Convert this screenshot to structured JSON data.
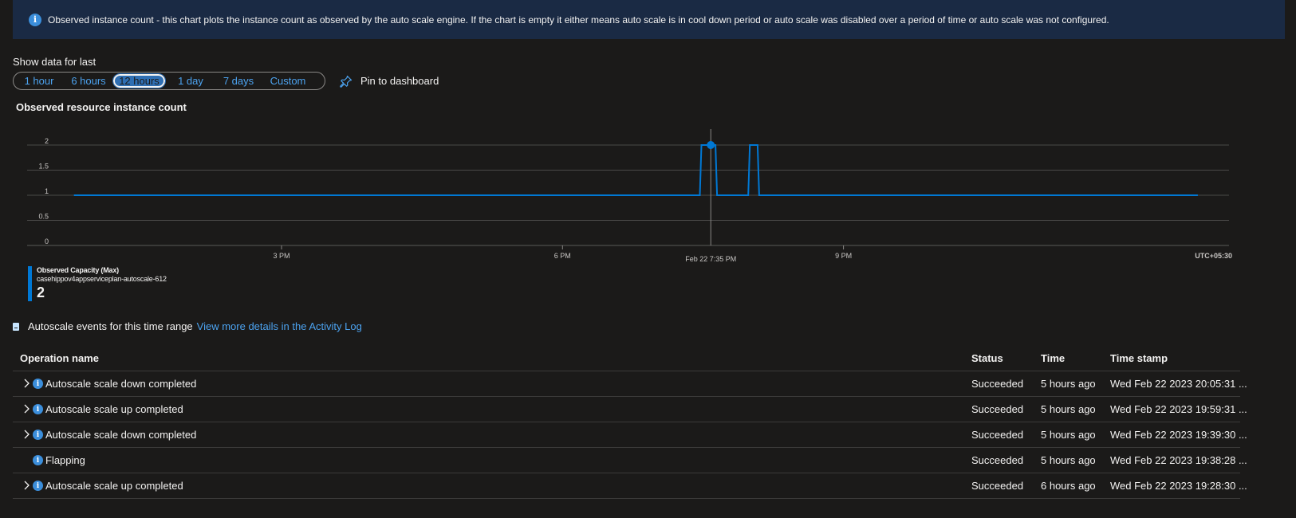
{
  "banner": {
    "text": "Observed instance count - this chart plots the instance count as observed by the auto scale engine. If the chart is empty it either means auto scale is in cool down period or auto scale was disabled over a period of time or auto scale was not configured."
  },
  "time_range": {
    "label": "Show data for last",
    "options": [
      "1 hour",
      "6 hours",
      "12 hours",
      "1 day",
      "7 days",
      "Custom"
    ],
    "selected": "12 hours",
    "pin_label": "Pin to dashboard"
  },
  "chart_data": {
    "type": "line",
    "title": "Observed resource instance count",
    "x_ticks": [
      "3 PM",
      "6 PM",
      "9 PM"
    ],
    "y_ticks": [
      "2",
      "1.5",
      "1",
      "0.5",
      "0"
    ],
    "ylim": [
      0,
      2
    ],
    "timezone": "UTC+05:30",
    "cursor_label": "Feb 22 7:35 PM",
    "grid": true,
    "series": [
      {
        "name": "Observed Capacity (Max)",
        "color": "#0078d4",
        "points": [
          {
            "t": "12:47 PM",
            "v": 1
          },
          {
            "t": "7:28 PM",
            "v": 1
          },
          {
            "t": "7:29 PM",
            "v": 2
          },
          {
            "t": "7:38 PM",
            "v": 2
          },
          {
            "t": "7:39 PM",
            "v": 1
          },
          {
            "t": "7:59 PM",
            "v": 1
          },
          {
            "t": "8:00 PM",
            "v": 2
          },
          {
            "t": "8:05 PM",
            "v": 2
          },
          {
            "t": "8:06 PM",
            "v": 1
          },
          {
            "t": "12:47 AM",
            "v": 1
          }
        ],
        "cursor_point": {
          "t": "7:35 PM",
          "v": 2
        }
      }
    ],
    "legend": {
      "name": "Observed Capacity (Max)",
      "resource": "casehippov4appserviceplan-autoscale-612",
      "value": "2"
    }
  },
  "events": {
    "title": "Autoscale events for this time range",
    "link": "View more details in the Activity Log"
  },
  "table": {
    "headers": [
      "Operation name",
      "Status",
      "Time",
      "Time stamp"
    ],
    "rows": [
      {
        "op": "Autoscale scale down completed",
        "status": "Succeeded",
        "time": "5 hours ago",
        "stamp": "Wed Feb 22 2023 20:05:31 ...",
        "expandable": true
      },
      {
        "op": "Autoscale scale up completed",
        "status": "Succeeded",
        "time": "5 hours ago",
        "stamp": "Wed Feb 22 2023 19:59:31 ...",
        "expandable": true
      },
      {
        "op": "Autoscale scale down completed",
        "status": "Succeeded",
        "time": "5 hours ago",
        "stamp": "Wed Feb 22 2023 19:39:30 ...",
        "expandable": true
      },
      {
        "op": "Flapping",
        "status": "Succeeded",
        "time": "5 hours ago",
        "stamp": "Wed Feb 22 2023 19:38:28 ...",
        "expandable": false
      },
      {
        "op": "Autoscale scale up completed",
        "status": "Succeeded",
        "time": "6 hours ago",
        "stamp": "Wed Feb 22 2023 19:28:30 ...",
        "expandable": true
      }
    ]
  }
}
